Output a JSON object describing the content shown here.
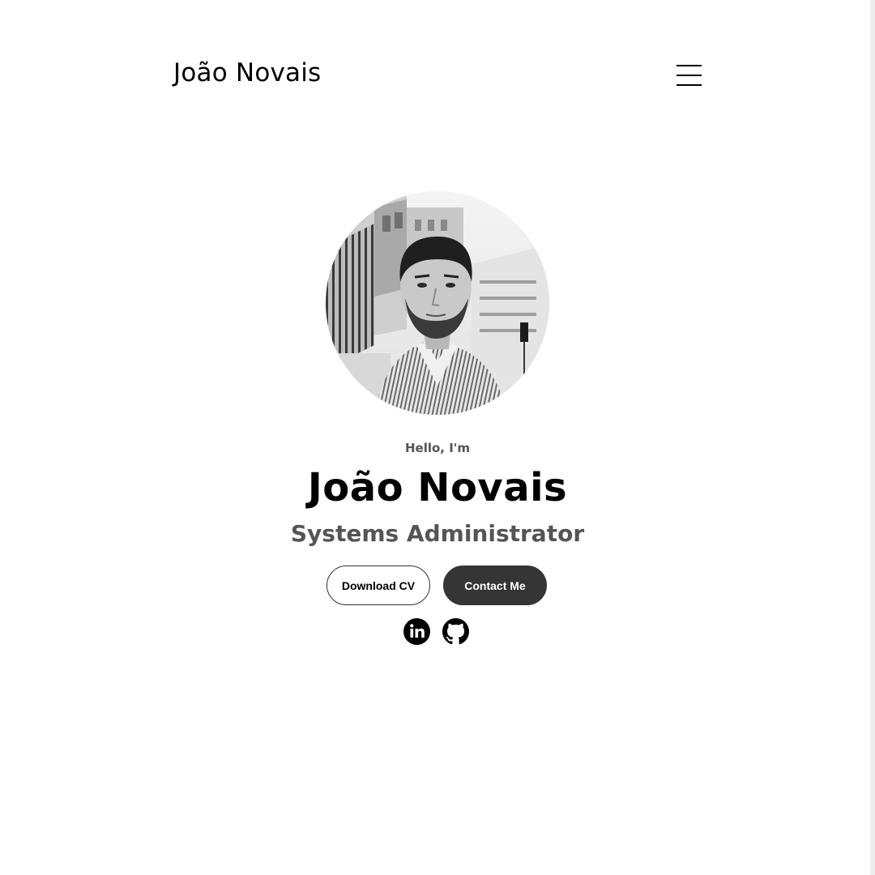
{
  "nav": {
    "logo": "João Novais",
    "menu_icon": "hamburger-menu-icon"
  },
  "hero": {
    "greeting": "Hello, I'm",
    "name": "João Novais",
    "title": "Systems Administrator",
    "photo_alt": "Profile picture"
  },
  "buttons": {
    "download_cv": "Download CV",
    "contact_me": "Contact Me"
  },
  "social": {
    "linkedin_icon": "linkedin-icon",
    "github_icon": "github-icon",
    "linkedin_alt": "My LinkedIn profile",
    "github_alt": "My Git profile"
  },
  "colors": {
    "text": "#000000",
    "muted": "#555555",
    "button_dark": "#353535",
    "background": "#ffffff"
  }
}
